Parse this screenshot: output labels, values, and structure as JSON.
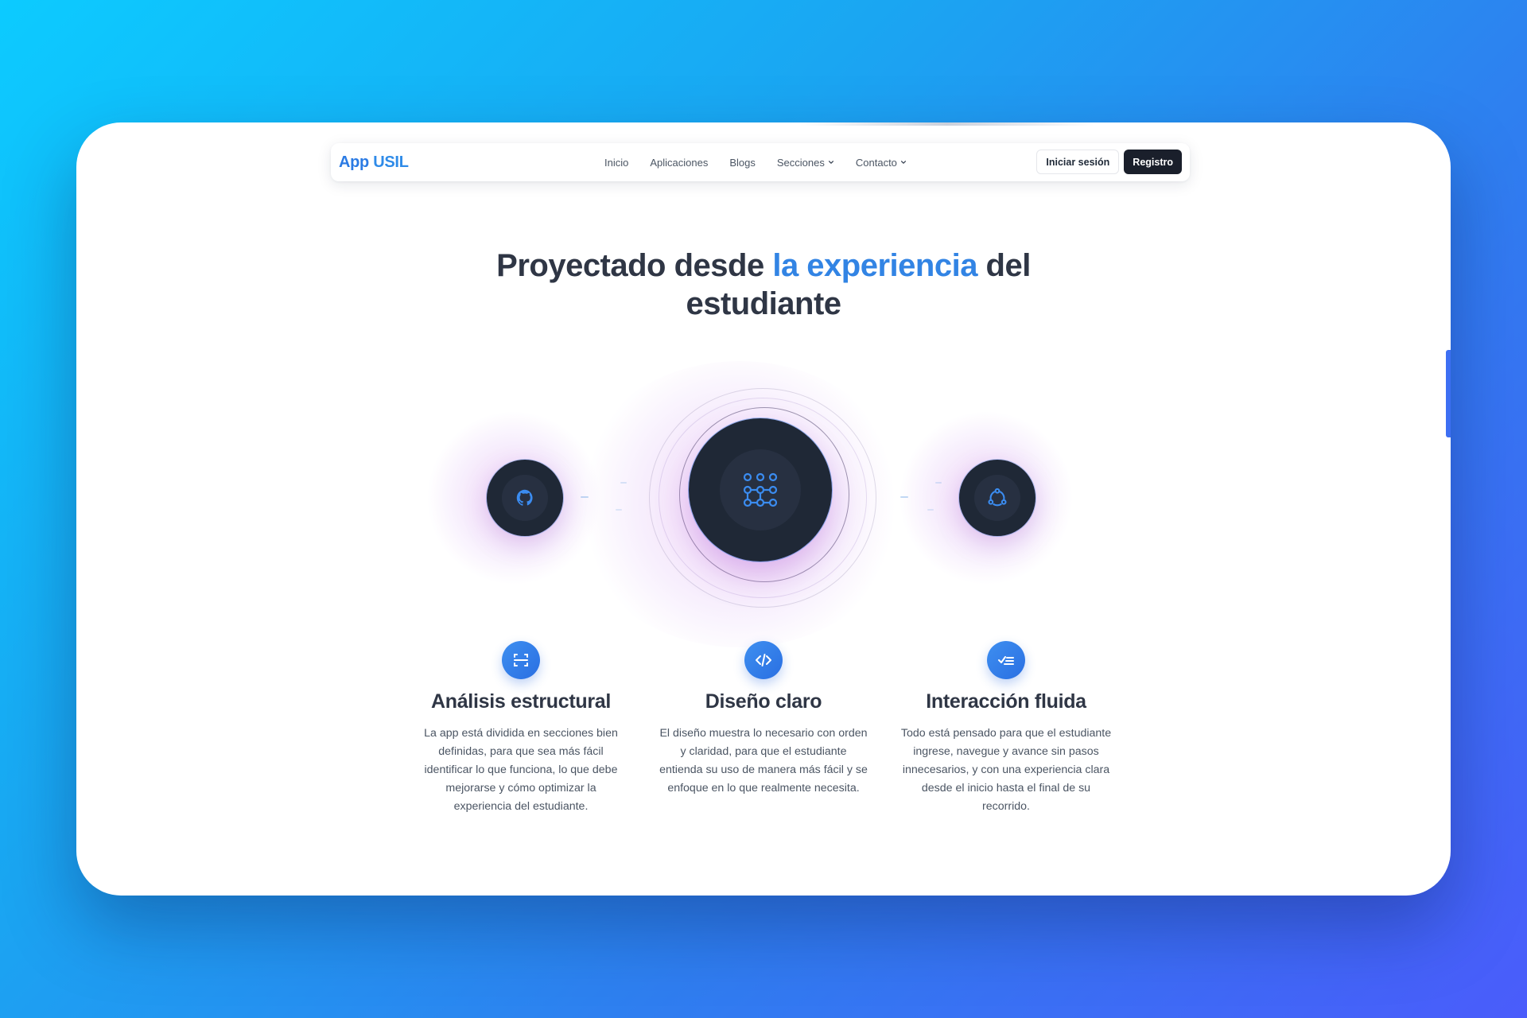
{
  "navbar": {
    "logo_part1": "App",
    "logo_part2": "USIL",
    "links": [
      {
        "label": "Inicio"
      },
      {
        "label": "Aplicaciones"
      },
      {
        "label": "Blogs"
      },
      {
        "label": "Secciones",
        "dropdown": true
      },
      {
        "label": "Contacto",
        "dropdown": true
      }
    ],
    "login_label": "Iniciar sesión",
    "register_label": "Registro"
  },
  "hero": {
    "title_part1": "Proyectado desde ",
    "title_highlight": "la experiencia",
    "title_part2": " del",
    "title_line2": "estudiante"
  },
  "orbit": {
    "left_icon": "github-icon",
    "center_icon": "grid-network-icon",
    "right_icon": "share-cycle-icon"
  },
  "features": [
    {
      "icon": "scan-icon",
      "title": "Análisis estructural",
      "text_lines": [
        "La app está dividida en secciones bien",
        "definidas, para que sea más fácil",
        "identificar lo que funciona, lo que debe",
        "mejorarse y cómo optimizar la",
        "experiencia del estudiante."
      ]
    },
    {
      "icon": "code-icon",
      "title": "Diseño claro",
      "text_lines": [
        "El diseño muestra lo necesario con orden",
        "y claridad, para que el estudiante",
        "entienda su uso de manera más fácil y se",
        "enfoque en lo que realmente necesita."
      ]
    },
    {
      "icon": "checklist-icon",
      "title": "Interacción fluida",
      "text_lines": [
        "Todo está pensado para que el estudiante",
        "ingrese, navegue y avance sin pasos",
        "innecesarios, y con una experiencia clara",
        "desde el inicio hasta el final de su",
        "recorrido."
      ]
    }
  ],
  "colors": {
    "accent": "#3284e4",
    "dark": "#1f2836",
    "heading": "#2f3645"
  }
}
